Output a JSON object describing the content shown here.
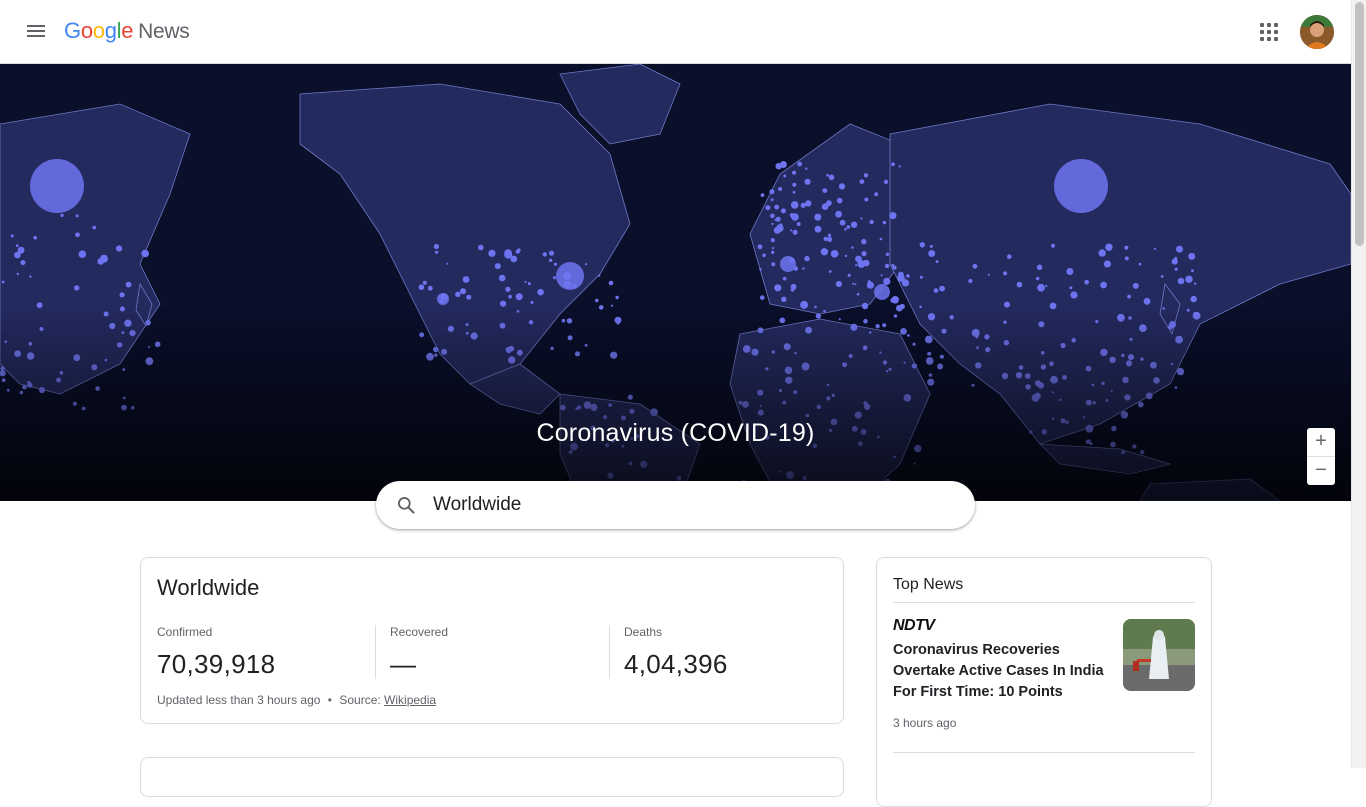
{
  "header": {
    "logo_google": [
      "G",
      "o",
      "o",
      "g",
      "l",
      "e"
    ],
    "logo_colors": [
      "#4285F4",
      "#EA4335",
      "#FBBC05",
      "#4285F4",
      "#34A853",
      "#EA4335"
    ],
    "logo_news": "News"
  },
  "map": {
    "title": "Coronavirus (COVID-19)",
    "zoom_in": "+",
    "zoom_out": "−",
    "colors": {
      "ocean": "#0a0f2a",
      "land": "#232a5e",
      "borders": "#6f78c8",
      "bubbles": "#6e74f0"
    }
  },
  "search": {
    "value": "Worldwide",
    "placeholder": "Search"
  },
  "stats": {
    "title": "Worldwide",
    "confirmed_label": "Confirmed",
    "confirmed_value": "70,39,918",
    "recovered_label": "Recovered",
    "recovered_value": "—",
    "deaths_label": "Deaths",
    "deaths_value": "4,04,396",
    "updated_text": "Updated less than 3 hours ago",
    "separator": "•",
    "source_prefix": "Source:",
    "source_link": "Wikipedia"
  },
  "top_news": {
    "title": "Top News",
    "items": [
      {
        "source": "NDTV",
        "headline": "Coronavirus Recoveries Overtake Active Cases In India For First Time: 10 Points",
        "time": "3 hours ago"
      }
    ]
  }
}
